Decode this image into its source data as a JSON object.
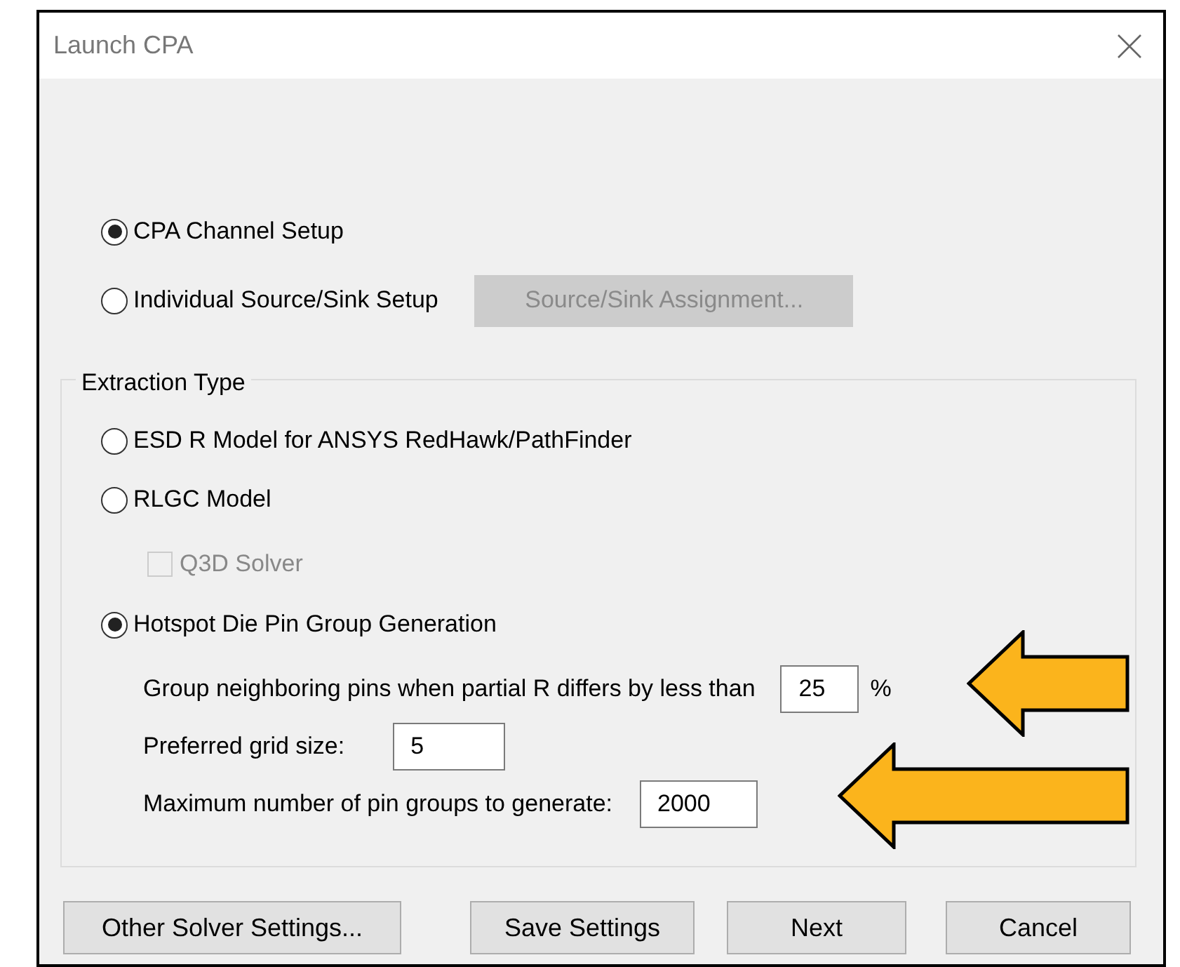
{
  "window": {
    "title": "Launch CPA"
  },
  "setup_options": [
    {
      "label": "CPA Channel Setup",
      "selected": true
    },
    {
      "label": "Individual Source/Sink Setup",
      "selected": false,
      "button": {
        "label": "Source/Sink Assignment...",
        "disabled": true
      }
    }
  ],
  "extraction_type": {
    "title": "Extraction Type",
    "options": [
      {
        "label": "ESD R Model for ANSYS RedHawk/PathFinder",
        "selected": false
      },
      {
        "label": "RLGC Model",
        "selected": false,
        "sub_checkbox": {
          "label": "Q3D Solver",
          "checked": false,
          "disabled": true
        }
      },
      {
        "label": "Hotspot Die Pin Group Generation",
        "selected": true
      }
    ],
    "fields": [
      {
        "label": "Group neighboring pins when partial R differs by less than",
        "value": "25",
        "unit": "%"
      },
      {
        "label": "Preferred grid size:",
        "value": "5"
      },
      {
        "label": "Maximum number of pin groups to generate:",
        "value": "2000"
      }
    ]
  },
  "buttons": [
    "Other Solver Settings...",
    "Save Settings",
    "Next",
    "Cancel"
  ]
}
